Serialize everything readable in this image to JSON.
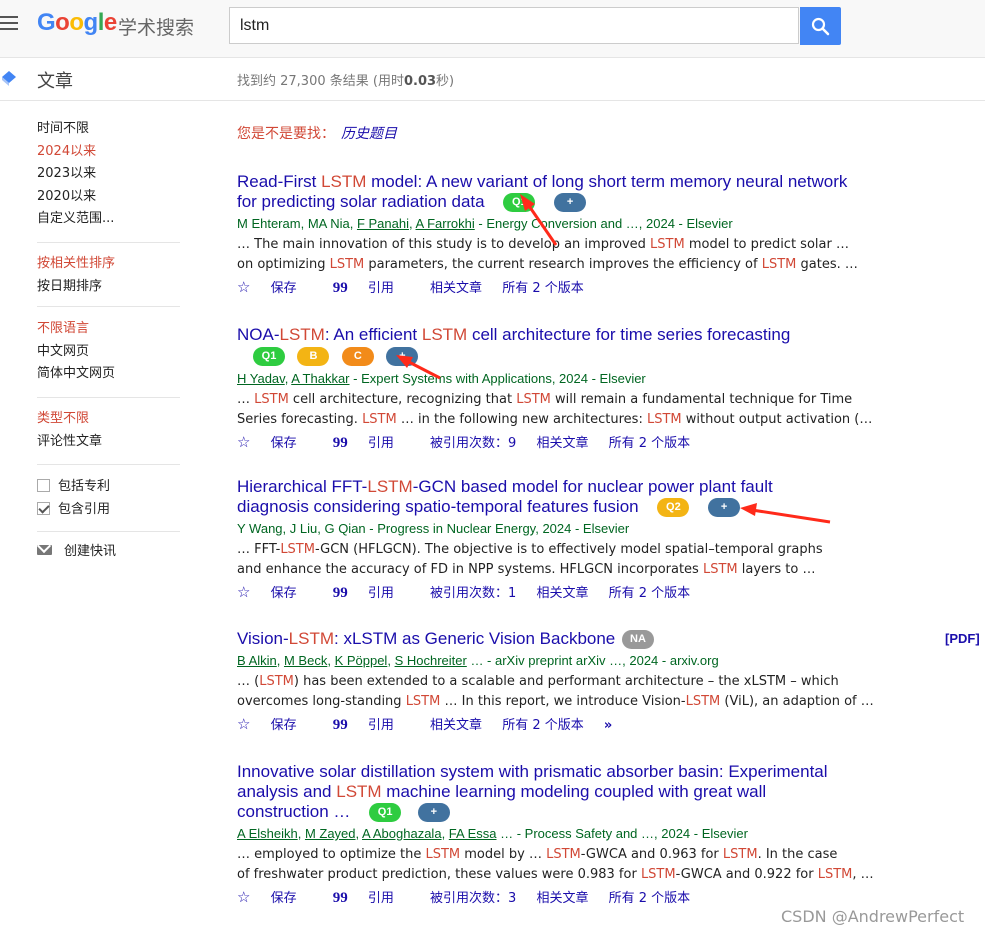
{
  "header": {
    "logo_sub": "学术搜索",
    "query": "lstm"
  },
  "subbar": {
    "title": "文章",
    "stats_prefix": "找到约 27,300 条结果  (用时",
    "stats_time": "0.03",
    "stats_suffix": "秒)"
  },
  "sidebar": {
    "time": [
      "时间不限",
      "2024以来",
      "2023以来",
      "2020以来",
      "自定义范围..."
    ],
    "sort": [
      "按相关性排序",
      "按日期排序"
    ],
    "lang": [
      "不限语言",
      "中文网页",
      "简体中文网页"
    ],
    "type": [
      "类型不限",
      "评论性文章"
    ],
    "patents": "包括专利",
    "citations": "包含引用",
    "alert": "创建快讯"
  },
  "didyoumean": {
    "label": "您是不是要找：",
    "suggestion": "历史题目"
  },
  "results": [
    {
      "title_parts": [
        "Read-First ",
        "LSTM",
        " model: A new variant of long short term memory neural network"
      ],
      "title_line2": "for predicting solar radiation data",
      "badges": [
        "Q1",
        "+"
      ],
      "authors": [
        "M Ehteram",
        "MA Nia",
        "F Panahi",
        "A Farrokhi"
      ],
      "source": "- Energy Conversion and …, 2024 - Elsevier",
      "snippet1": [
        "… The main innovation of this study is to develop an improved ",
        "LSTM",
        " model to predict solar …"
      ],
      "snippet2": [
        "on optimizing ",
        "LSTM",
        " parameters, the current research improves the efficiency of ",
        "LSTM",
        " gates. …"
      ],
      "actions": [
        "保存",
        "引用",
        "相关文章",
        "所有 2 个版本"
      ]
    },
    {
      "title_parts": [
        "NOA-",
        "LSTM",
        ": An efficient ",
        "LSTM",
        " cell architecture for time series forecasting"
      ],
      "badges": [
        "Q1",
        "B",
        "C",
        "+"
      ],
      "authors": [
        "H Yadav",
        "A Thakkar"
      ],
      "source": "- Expert Systems with Applications, 2024 - Elsevier",
      "snippet1": [
        "… ",
        "LSTM",
        " cell architecture, recognizing that ",
        "LSTM",
        " will remain a fundamental technique for Time"
      ],
      "snippet2": [
        "Series forecasting. ",
        "LSTM",
        " … in the following new architectures: ",
        "LSTM",
        " without output activation (…"
      ],
      "actions": [
        "保存",
        "引用",
        "被引用次数：9",
        "相关文章",
        "所有 2 个版本"
      ]
    },
    {
      "title_parts": [
        "Hierarchical FFT-",
        "LSTM",
        "-GCN based model for nuclear power plant fault"
      ],
      "title_line2": "diagnosis considering spatio-temporal features fusion",
      "badges": [
        "Q2",
        "+"
      ],
      "authors": [
        "Y Wang",
        "J Liu",
        "G Qian"
      ],
      "source": "- Progress in Nuclear Energy, 2024 - Elsevier",
      "snippet1": [
        "… FFT-",
        "LSTM",
        "-GCN (HFLGCN). The objective is to effectively model spatial–temporal graphs"
      ],
      "snippet2": [
        "and enhance the accuracy of FD in NPP systems. HFLGCN incorporates ",
        "LSTM",
        " layers to …"
      ],
      "actions": [
        "保存",
        "引用",
        "被引用次数：1",
        "相关文章",
        "所有 2 个版本"
      ]
    },
    {
      "title_parts": [
        "Vision-",
        "LSTM",
        ": xLSTM as Generic Vision Backbone"
      ],
      "badges": [
        "NA"
      ],
      "pdf": "[PDF]",
      "authors": [
        "B Alkin",
        "M Beck",
        "K Pöppel",
        "S Hochreiter"
      ],
      "source": "… - arXiv preprint arXiv …, 2024 - arxiv.org",
      "snippet1": [
        "… (",
        "LSTM",
        ") has been extended to a scalable and performant architecture – the xLSTM – which"
      ],
      "snippet2": [
        "overcomes long-standing ",
        "LSTM",
        " … In this report, we introduce Vision-",
        "LSTM",
        " (ViL), an adaption of …"
      ],
      "actions": [
        "保存",
        "引用",
        "相关文章",
        "所有 2 个版本"
      ]
    },
    {
      "title_line1": "Innovative solar distillation system with prismatic absorber basin: Experimental",
      "title_parts": [
        "analysis and ",
        "LSTM",
        " machine learning modeling coupled with great wall"
      ],
      "title_line3": "construction …",
      "badges": [
        "Q1",
        "+"
      ],
      "authors": [
        "A Elsheikh",
        "M Zayed",
        "A Aboghazala",
        "FA Essa"
      ],
      "source": "… - Process Safety and …, 2024 - Elsevier",
      "snippet1": [
        "… employed to optimize the ",
        "LSTM",
        " model by … ",
        "LSTM",
        "-GWCA and 0.963 for ",
        "LSTM",
        ". In the case"
      ],
      "snippet2": [
        "of freshwater product prediction, these values were 0.983 for ",
        "LSTM",
        "-GWCA and 0.922 for ",
        "LSTM",
        ", …"
      ],
      "actions": [
        "保存",
        "引用",
        "被引用次数：3",
        "相关文章",
        "所有 2 个版本"
      ]
    }
  ],
  "watermark": "CSDN @AndrewPerfect",
  "colors": {
    "accent": "#4285f4",
    "link": "#1a0dab",
    "highlight": "#d14836",
    "author": "#006621",
    "annotation": "#ff2a1a"
  }
}
